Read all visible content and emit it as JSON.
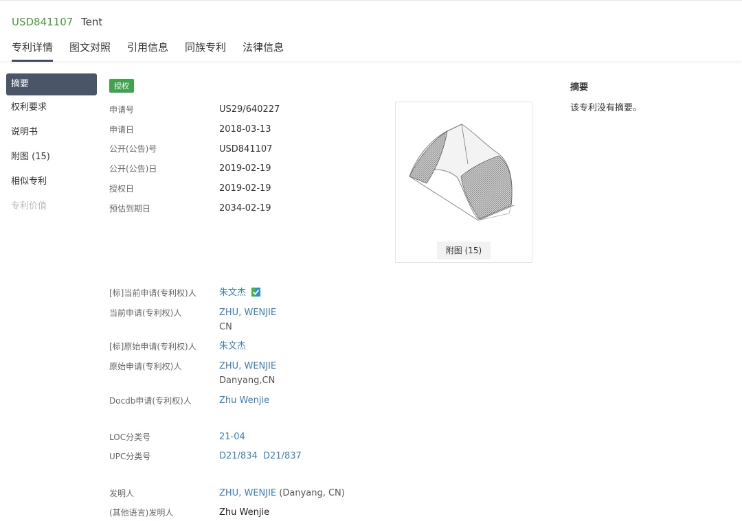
{
  "header": {
    "patent_number": "USD841107",
    "title": "Tent",
    "tabs": [
      "专利详情",
      "图文对照",
      "引用信息",
      "同族专利",
      "法律信息"
    ]
  },
  "sidebar": {
    "items": [
      {
        "label": "摘要"
      },
      {
        "label": "权利要求"
      },
      {
        "label": "说明书"
      },
      {
        "label": "附图 (15)"
      },
      {
        "label": "相似专利"
      },
      {
        "label": "专利价值"
      }
    ]
  },
  "status_badge": "授权",
  "bib": {
    "application_no": {
      "label": "申请号",
      "value": "US29/640227"
    },
    "application_date": {
      "label": "申请日",
      "value": "2018-03-13"
    },
    "publication_no": {
      "label": "公开(公告)号",
      "value": "USD841107"
    },
    "publication_date": {
      "label": "公开(公告)日",
      "value": "2019-02-19"
    },
    "grant_date": {
      "label": "授权日",
      "value": "2019-02-19"
    },
    "expiry_date": {
      "label": "预估到期日",
      "value": "2034-02-19"
    }
  },
  "parties": {
    "std_current_applicant": {
      "label": "[标]当前申请(专利权)人",
      "value": "朱文杰"
    },
    "current_applicant": {
      "label": "当前申请(专利权)人",
      "value": "ZHU, WENJIE",
      "sub": "CN"
    },
    "std_original_applicant": {
      "label": "[标]原始申请(专利权)人",
      "value": "朱文杰"
    },
    "original_applicant": {
      "label": "原始申请(专利权)人",
      "value": "ZHU, WENJIE",
      "sub": "Danyang,CN"
    },
    "docdb_applicant": {
      "label": "Docdb申请(专利权)人",
      "value": "Zhu Wenjie"
    }
  },
  "classification": {
    "loc": {
      "label": "LOC分类号",
      "value": "21-04"
    },
    "upc": {
      "label": "UPC分类号",
      "values": [
        "D21/834",
        "D21/837"
      ]
    }
  },
  "inventors": {
    "inventor": {
      "label": "发明人",
      "value": "ZHU, WENJIE",
      "suffix": "(Danyang, CN)"
    },
    "other_lang": {
      "label": "(其他语言)发明人",
      "value": "Zhu Wenjie"
    }
  },
  "figure": {
    "caption": "附图 (15)"
  },
  "abstract": {
    "title": "摘要",
    "text": "该专利没有摘要。"
  }
}
